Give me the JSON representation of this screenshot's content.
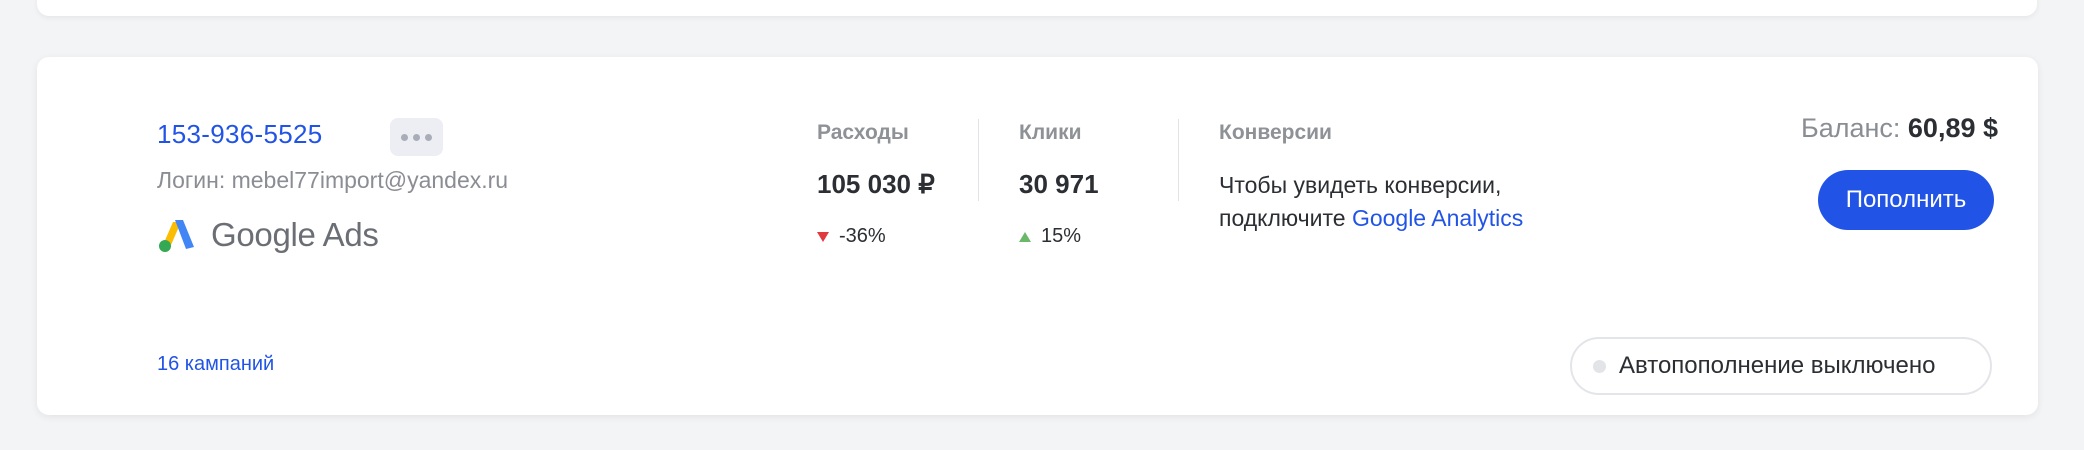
{
  "account": {
    "id": "153-936-5525",
    "login": "Логин: mebel77import@yandex.ru",
    "platform": "Google Ads"
  },
  "metrics": {
    "spend": {
      "label": "Расходы",
      "value": "105 030 ₽",
      "change": "-36%",
      "direction": "down"
    },
    "clicks": {
      "label": "Клики",
      "value": "30 971",
      "change": "15%",
      "direction": "up"
    }
  },
  "conversions": {
    "label": "Конверсии",
    "text_line1": "Чтобы увидеть конверсии,",
    "text_line2_prefix": "подключите ",
    "link": "Google Analytics"
  },
  "balance": {
    "label": "Баланс:",
    "value": "60,89 $"
  },
  "actions": {
    "topup": "Пополнить",
    "campaigns": "16 кампаний",
    "autopay": "Автопополнение выключено"
  },
  "colors": {
    "accent": "#2154e6",
    "negative": "#e0393e",
    "positive": "#6cb86a"
  }
}
